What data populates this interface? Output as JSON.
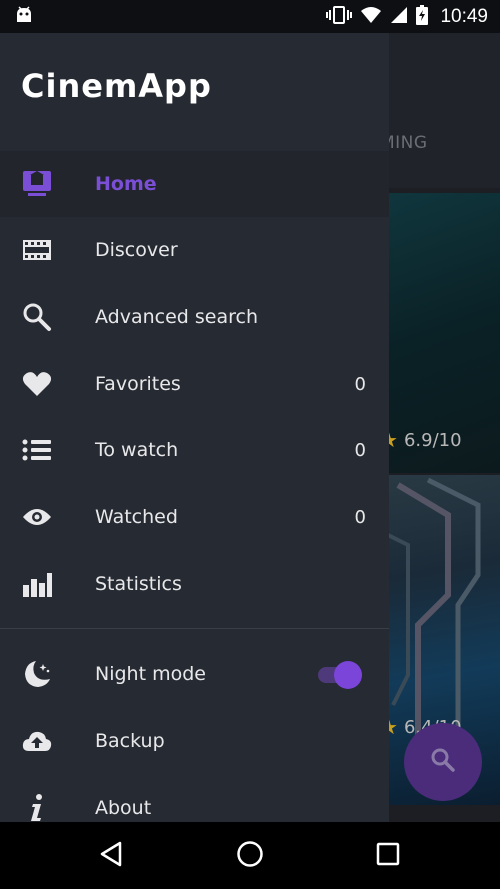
{
  "status_bar": {
    "time": "10:49",
    "icons": [
      "android-debug-icon",
      "vibrate-icon",
      "wifi-icon",
      "signal-icon",
      "battery-charging-icon"
    ]
  },
  "background": {
    "tab_partial": "MING",
    "ratings": [
      "6.9/10",
      "6.4/10"
    ],
    "fab_icon": "search-icon"
  },
  "drawer": {
    "logo": "CinemApp",
    "items": [
      {
        "label": "Home",
        "icon": "home-tv-icon",
        "count": "",
        "active": true
      },
      {
        "label": "Discover",
        "icon": "film-strip-icon",
        "count": ""
      },
      {
        "label": "Advanced search",
        "icon": "magnifier-icon",
        "count": ""
      },
      {
        "label": "Favorites",
        "icon": "heart-icon",
        "count": "0"
      },
      {
        "label": "To watch",
        "icon": "list-icon",
        "count": "0"
      },
      {
        "label": "Watched",
        "icon": "eye-icon",
        "count": "0"
      },
      {
        "label": "Statistics",
        "icon": "bar-chart-icon",
        "count": ""
      }
    ],
    "settings": [
      {
        "label": "Night mode",
        "icon": "moon-icon",
        "toggle_on": true
      },
      {
        "label": "Backup",
        "icon": "cloud-upload-icon"
      },
      {
        "label": "About",
        "icon": "info-icon"
      }
    ]
  },
  "colors": {
    "accent": "#7a4fd6",
    "drawer_bg": "#262a32",
    "text": "#e8e8ea"
  }
}
